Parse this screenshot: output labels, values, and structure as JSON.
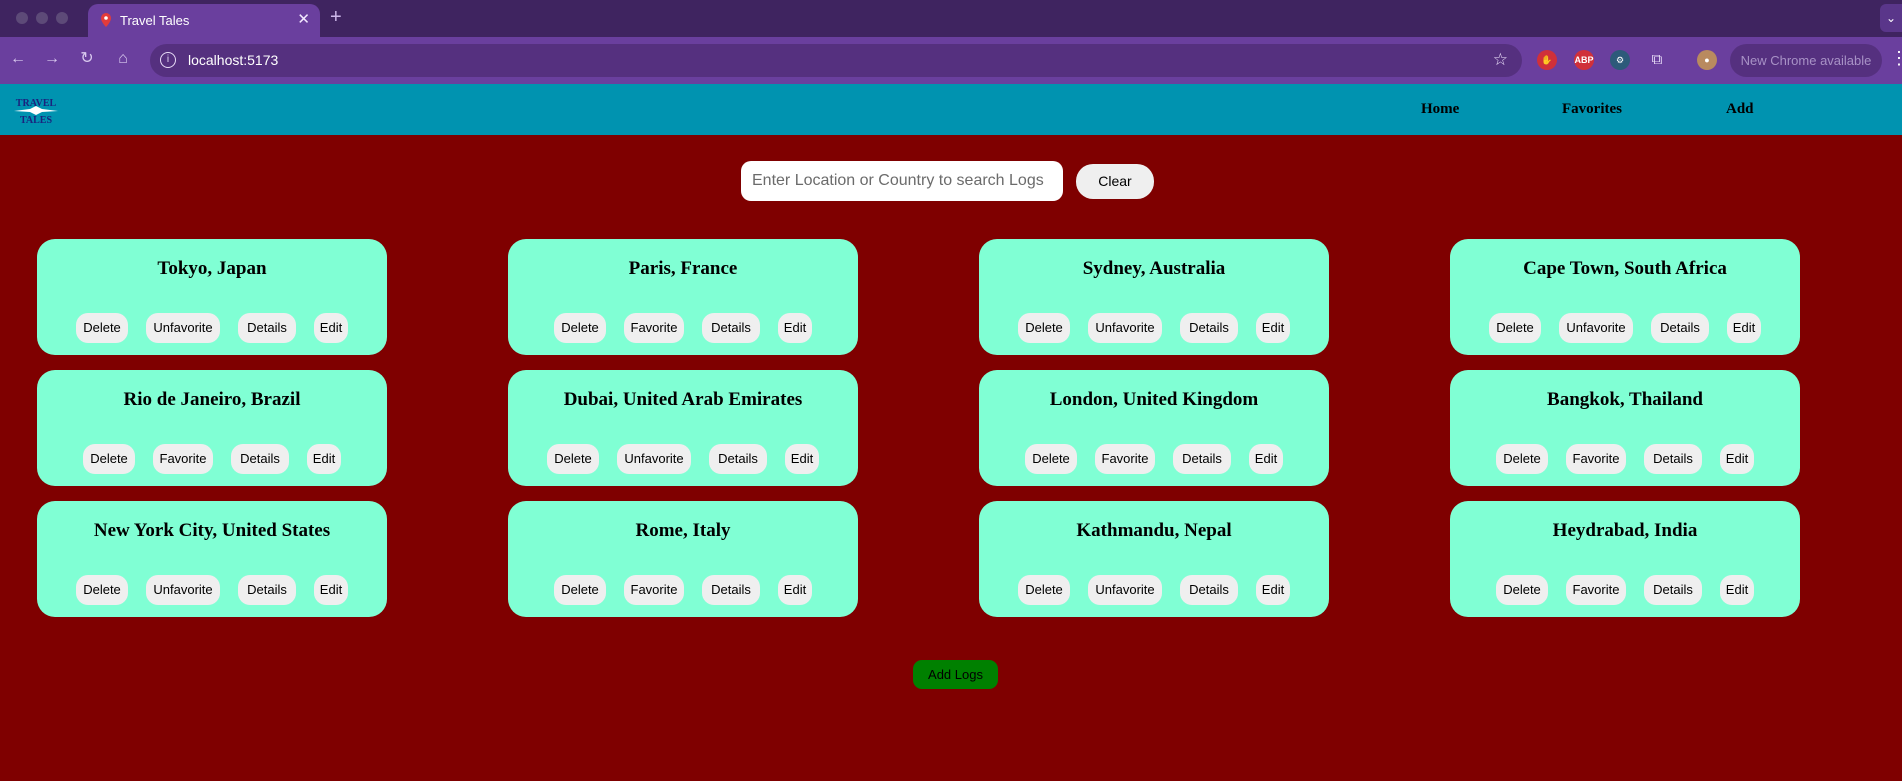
{
  "browser": {
    "tab_title": "Travel Tales",
    "url": "localhost:5173",
    "update_notice": "New Chrome available",
    "extensions": [
      "hand-extension",
      "ABP",
      "puzzle-ext",
      "extensions"
    ]
  },
  "app": {
    "logo_text_top": "TRAVEL",
    "logo_text_bottom": "TALES",
    "nav": {
      "home": "Home",
      "favorites": "Favorites",
      "add": "Add"
    },
    "search": {
      "placeholder": "Enter Location or Country to search Logs",
      "clear_label": "Clear"
    },
    "card_buttons": {
      "delete": "Delete",
      "details": "Details",
      "edit": "Edit"
    },
    "logs": [
      {
        "title": "Tokyo, Japan",
        "fav_label": "Unfavorite"
      },
      {
        "title": "Paris, France",
        "fav_label": "Favorite"
      },
      {
        "title": "Sydney, Australia",
        "fav_label": "Unfavorite"
      },
      {
        "title": "Cape Town, South Africa",
        "fav_label": "Unfavorite"
      },
      {
        "title": "Rio de Janeiro, Brazil",
        "fav_label": "Favorite"
      },
      {
        "title": "Dubai, United Arab Emirates",
        "fav_label": "Unfavorite"
      },
      {
        "title": "London, United Kingdom",
        "fav_label": "Favorite"
      },
      {
        "title": "Bangkok, Thailand",
        "fav_label": "Favorite"
      },
      {
        "title": "New York City, United States",
        "fav_label": "Unfavorite"
      },
      {
        "title": "Rome, Italy",
        "fav_label": "Favorite"
      },
      {
        "title": "Kathmandu, Nepal",
        "fav_label": "Unfavorite"
      },
      {
        "title": "Heydrabad, India",
        "fav_label": "Favorite"
      }
    ],
    "add_logs_label": "Add Logs"
  },
  "colors": {
    "page_background": "#7f0000",
    "header": "#0093b0",
    "card": "#80ffd4",
    "add_button": "#008000"
  }
}
